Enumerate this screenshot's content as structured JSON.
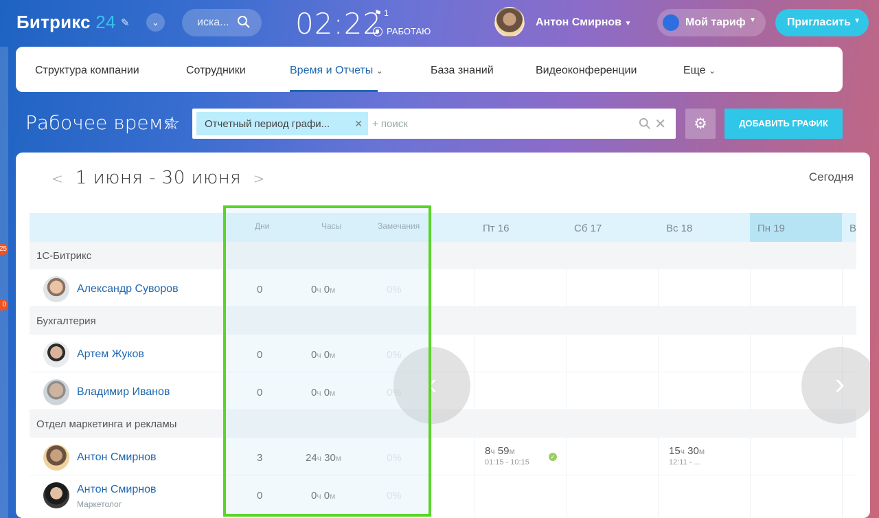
{
  "header": {
    "logo_text": "Битрикс",
    "logo_num": "24",
    "search_placeholder": "иска...",
    "clock": "02:22",
    "flag_count": "1",
    "work_status": "РАБОТАЮ",
    "user_name": "Антон Смирнов",
    "tariff_label": "Мой тариф",
    "invite_label": "Пригласить"
  },
  "nav": {
    "items": [
      "Структура компании",
      "Сотрудники",
      "Время и Отчеты",
      "База знаний",
      "Видеоконференции",
      "Еще"
    ],
    "active": "Время и Отчеты"
  },
  "page": {
    "title": "Рабочее время",
    "filter_chip": "Отчетный период графи...",
    "filter_plus": "+ поиск",
    "add_button": "ДОБАВИТЬ ГРАФИК"
  },
  "left_badges": [
    "25",
    "0"
  ],
  "report": {
    "period": "1 июня - 30 июня",
    "today": "Сегодня",
    "columns": {
      "days": "Дни",
      "hours": "Часы",
      "remarks": "Замечания"
    },
    "day_headers": [
      "Пт 16",
      "Сб 17",
      "Вс 18",
      "Пн 19",
      "В"
    ],
    "groups": [
      {
        "name": "1С-Битрикс",
        "employees": [
          {
            "name": "Александр Суворов",
            "position": "",
            "days": "0",
            "hours": "0",
            "minutes": "0",
            "remarks": "0%"
          }
        ]
      },
      {
        "name": "Бухгалтерия",
        "employees": [
          {
            "name": "Артем Жуков",
            "position": "",
            "days": "0",
            "hours": "0",
            "minutes": "0",
            "remarks": "0%"
          },
          {
            "name": "Владимир Иванов",
            "position": "",
            "days": "0",
            "hours": "0",
            "minutes": "0",
            "remarks": "0%"
          }
        ]
      },
      {
        "name": "Отдел маркетинга и рекламы",
        "employees": [
          {
            "name": "Антон Смирнов",
            "position": "",
            "days": "3",
            "hours": "24",
            "minutes": "30",
            "remarks": "0%"
          },
          {
            "name": "Антон Смирнов",
            "position": "Маркетолог",
            "days": "0",
            "hours": "0",
            "minutes": "0",
            "remarks": "0%"
          }
        ]
      }
    ],
    "cells": [
      {
        "day": "Пт 16",
        "hours": "8",
        "minutes": "59",
        "range": "01:15 - 10:15",
        "approved": true
      },
      {
        "day": "Вс 18",
        "hours": "15",
        "minutes": "30",
        "range": "12:11 - ..."
      }
    ],
    "units": {
      "h": "ч",
      "m": "м"
    }
  },
  "colors": {
    "accent": "#30c6e8",
    "link": "#2067b0",
    "highlight": "#59d428"
  }
}
